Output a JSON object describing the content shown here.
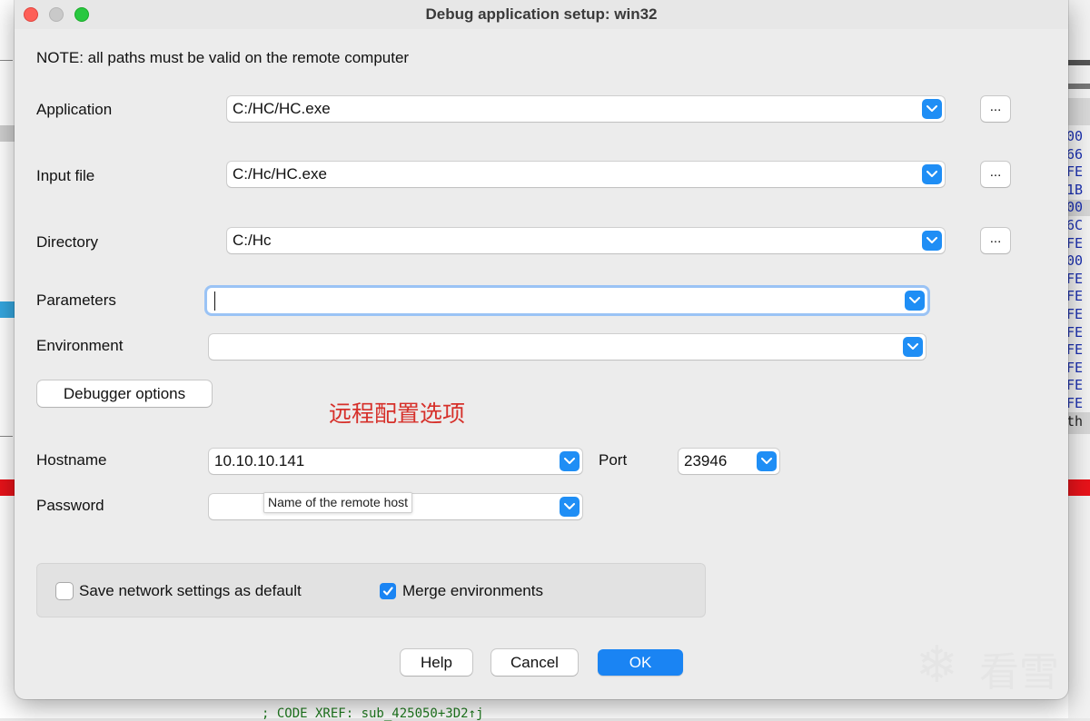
{
  "window": {
    "title": "Debug application setup: win32"
  },
  "note": "NOTE: all paths must be valid on the remote computer",
  "fields": {
    "application": {
      "label": "Application",
      "value": "C:/HC/HC.exe",
      "browse_label": "..."
    },
    "input_file": {
      "label": "Input file",
      "value": "C:/Hc/HC.exe",
      "browse_label": "..."
    },
    "directory": {
      "label": "Directory",
      "value": "C:/Hc",
      "browse_label": "..."
    },
    "parameters": {
      "label": "Parameters",
      "value": ""
    },
    "environment": {
      "label": "Environment",
      "value": ""
    }
  },
  "debugger_options_label": "Debugger options",
  "annotation": "远程配置选项",
  "remote": {
    "hostname_label": "Hostname",
    "hostname_value": "10.10.10.141",
    "port_label": "Port",
    "port_value": "23946",
    "password_label": "Password",
    "password_value": "",
    "tooltip": "Name of the remote host"
  },
  "checkboxes": {
    "save_network": {
      "label": "Save network settings as default",
      "checked": false
    },
    "merge_env": {
      "label": "Merge environments",
      "checked": true
    }
  },
  "buttons": {
    "help": "Help",
    "cancel": "Cancel",
    "ok": "OK"
  },
  "background": {
    "hex_values": [
      "00",
      "66",
      "FE",
      "1B",
      "00",
      "6C",
      "FE",
      "00",
      "FE",
      "FE",
      "FE",
      "FE",
      "FE",
      "FE",
      "FE",
      "FE"
    ],
    "hex_tail": "th",
    "code_line": "; CODE XREF: sub_425050+3D2↑j"
  },
  "watermark": {
    "text": "看雪",
    "icon": "snowflake-icon"
  },
  "colors": {
    "accent": "#1a84f3",
    "annotation": "#d6302a"
  }
}
